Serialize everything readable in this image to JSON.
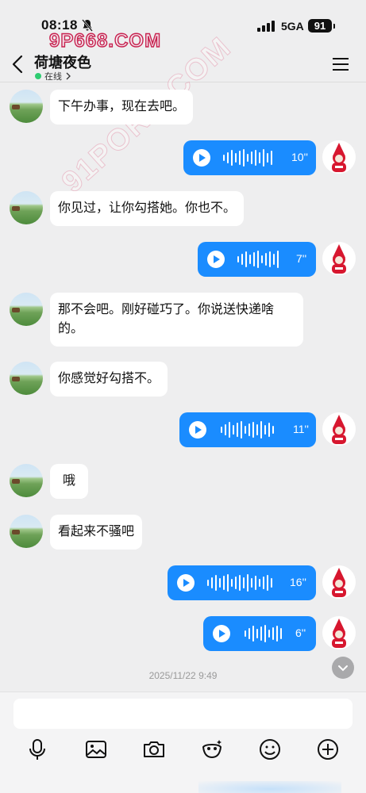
{
  "status_bar": {
    "time": "08:18",
    "network": "5GA",
    "battery": "91"
  },
  "watermark": {
    "top": "9P668.COM",
    "diagonal": "91PORN.COM"
  },
  "header": {
    "title": "荷塘夜色",
    "presence": "在线"
  },
  "messages": [
    {
      "side": "in",
      "type": "text",
      "text": "下午办事，现在去吧。"
    },
    {
      "side": "out",
      "type": "voice",
      "duration": "10''"
    },
    {
      "side": "in",
      "type": "text",
      "text": "你见过，让你勾搭她。你也不。"
    },
    {
      "side": "out",
      "type": "voice",
      "duration": "7''"
    },
    {
      "side": "in",
      "type": "text",
      "lines": [
        "那不会吧。刚好碰巧了。你说送快递啥",
        "的。"
      ]
    },
    {
      "side": "in",
      "type": "text",
      "text": "你感觉好勾搭不。"
    },
    {
      "side": "out",
      "type": "voice",
      "duration": "11''"
    },
    {
      "side": "in",
      "type": "text",
      "text": "哦"
    },
    {
      "side": "in",
      "type": "text",
      "text": "看起来不骚吧"
    },
    {
      "side": "out",
      "type": "voice",
      "duration": "16''"
    },
    {
      "side": "out",
      "type": "voice",
      "duration": "6''"
    }
  ],
  "timestamp": "2025/11/22 9:49",
  "input": {
    "placeholder": ""
  },
  "toolbar_icons": [
    "microphone-icon",
    "image-icon",
    "camera-icon",
    "sticker-icon",
    "emoji-icon",
    "plus-icon"
  ],
  "colors": {
    "accent": "#1a8cff",
    "background": "#eeeeef",
    "online": "#2ecc71"
  }
}
